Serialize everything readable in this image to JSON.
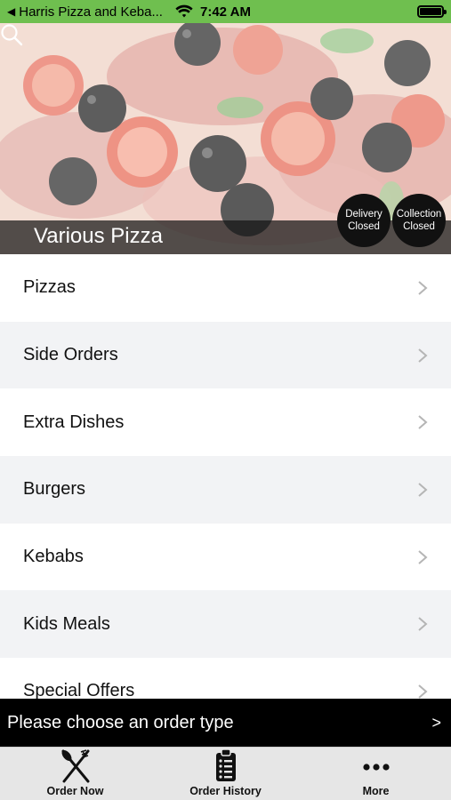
{
  "status_bar": {
    "back_glyph": "◀",
    "app_name": "Harris Pizza and Keba...",
    "time": "7:42 AM"
  },
  "hero": {
    "title": "Various Pizza",
    "delivery_badge": {
      "line1": "Delivery",
      "line2": "Closed"
    },
    "collection_badge": {
      "line1": "Collection",
      "line2": "Closed"
    }
  },
  "menu": {
    "items": [
      {
        "label": "Pizzas"
      },
      {
        "label": "Side Orders"
      },
      {
        "label": "Extra Dishes"
      },
      {
        "label": "Burgers"
      },
      {
        "label": "Kebabs"
      },
      {
        "label": "Kids Meals"
      },
      {
        "label": "Special Offers"
      }
    ]
  },
  "order_bar": {
    "text": "Please choose an order type",
    "arrow": ">"
  },
  "tabs": [
    {
      "label": "Order Now",
      "icon": "fork-knife-icon"
    },
    {
      "label": "Order History",
      "icon": "clipboard-icon"
    },
    {
      "label": "More",
      "icon": "more-dots-icon"
    }
  ],
  "colors": {
    "status_bar": "#6fbf4f",
    "order_bar": "#000000",
    "tab_bar": "#e6e6e6",
    "alt_row": "#f2f3f5"
  }
}
